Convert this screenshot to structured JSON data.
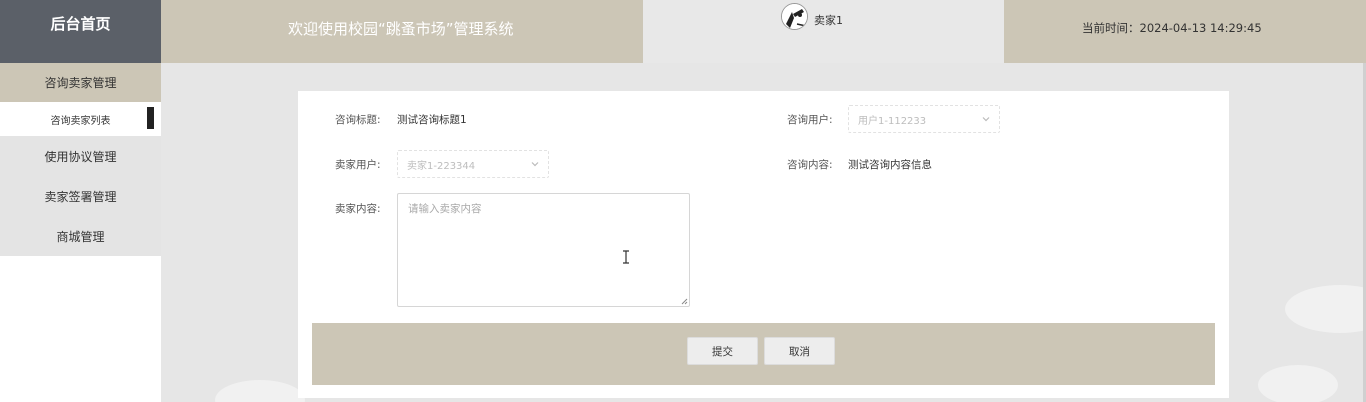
{
  "sidebar": {
    "home_label": "后台首页",
    "menu": [
      {
        "label": "咨询卖家管理"
      },
      {
        "label": "咨询卖家列表"
      },
      {
        "label": "使用协议管理"
      },
      {
        "label": "卖家签署管理"
      },
      {
        "label": "商城管理"
      }
    ]
  },
  "header": {
    "title": "欢迎使用校园“跳蚤市场”管理系统",
    "user_name": "卖家1",
    "time": "当前时间：2024-04-13 14:29:45"
  },
  "form": {
    "title_label": "咨询标题:",
    "title_value": "测试咨询标题1",
    "user_label": "咨询用户:",
    "user_value": "用户1-112233",
    "seller_label": "卖家用户:",
    "seller_value": "卖家1-223344",
    "content_label": "咨询内容:",
    "content_value": "测试咨询内容信息",
    "reply_label": "卖家内容:",
    "reply_placeholder": "请输入卖家内容",
    "submit_label": "提交",
    "cancel_label": "取消"
  },
  "colors": {
    "sidebar_dark": "#5b6068",
    "accent_beige": "#ccc6b6",
    "page_bg": "#e6e6e6"
  },
  "icons": {
    "select_arrow": "chevron-down-icon",
    "avatar": "user-avatar-icon",
    "cursor": "text-cursor-icon"
  }
}
